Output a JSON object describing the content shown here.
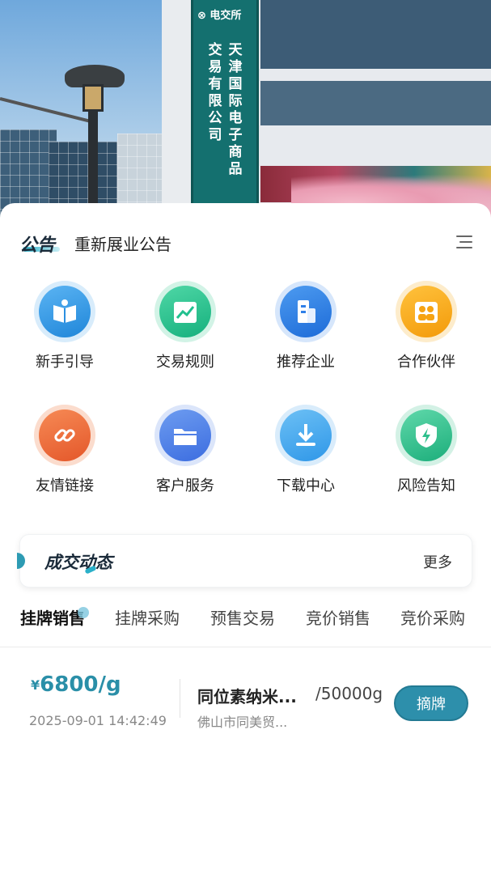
{
  "hero": {
    "sign_logo": "电交所",
    "sign_col1": "天津国际电子商品",
    "sign_col2": "交易有限公司"
  },
  "notice": {
    "badge": "公告",
    "text": "重新展业公告",
    "menu_icon": "menu-icon"
  },
  "grid": [
    {
      "label": "新手引导",
      "icon": "book-icon",
      "color": "#2b8fe0"
    },
    {
      "label": "交易规则",
      "icon": "chart-icon",
      "color": "#22c08f"
    },
    {
      "label": "推荐企业",
      "icon": "building-icon",
      "color": "#2f7fe8"
    },
    {
      "label": "合作伙伴",
      "icon": "partners-icon",
      "color": "#f6a313"
    },
    {
      "label": "友情链接",
      "icon": "link-icon",
      "color": "#ee6b3c"
    },
    {
      "label": "客户服务",
      "icon": "folder-icon",
      "color": "#4f7fe6"
    },
    {
      "label": "下载中心",
      "icon": "download-icon",
      "color": "#3fa6ee"
    },
    {
      "label": "风险告知",
      "icon": "shield-icon",
      "color": "#2fbf8c"
    }
  ],
  "deals": {
    "title": "成交动态",
    "more": "更多"
  },
  "tabs": [
    "挂牌销售",
    "挂牌采购",
    "预售交易",
    "竞价销售",
    "竞价采购"
  ],
  "listing": {
    "currency": "¥",
    "price": "6800/g",
    "timestamp": "2025-09-01 14:42:49",
    "product": "同位素纳米...",
    "quantity": "/50000g",
    "company": "佛山市同美贸...",
    "action": "摘牌"
  },
  "colors": {
    "accent": "#2d8fab",
    "price": "#2a8fa8"
  }
}
